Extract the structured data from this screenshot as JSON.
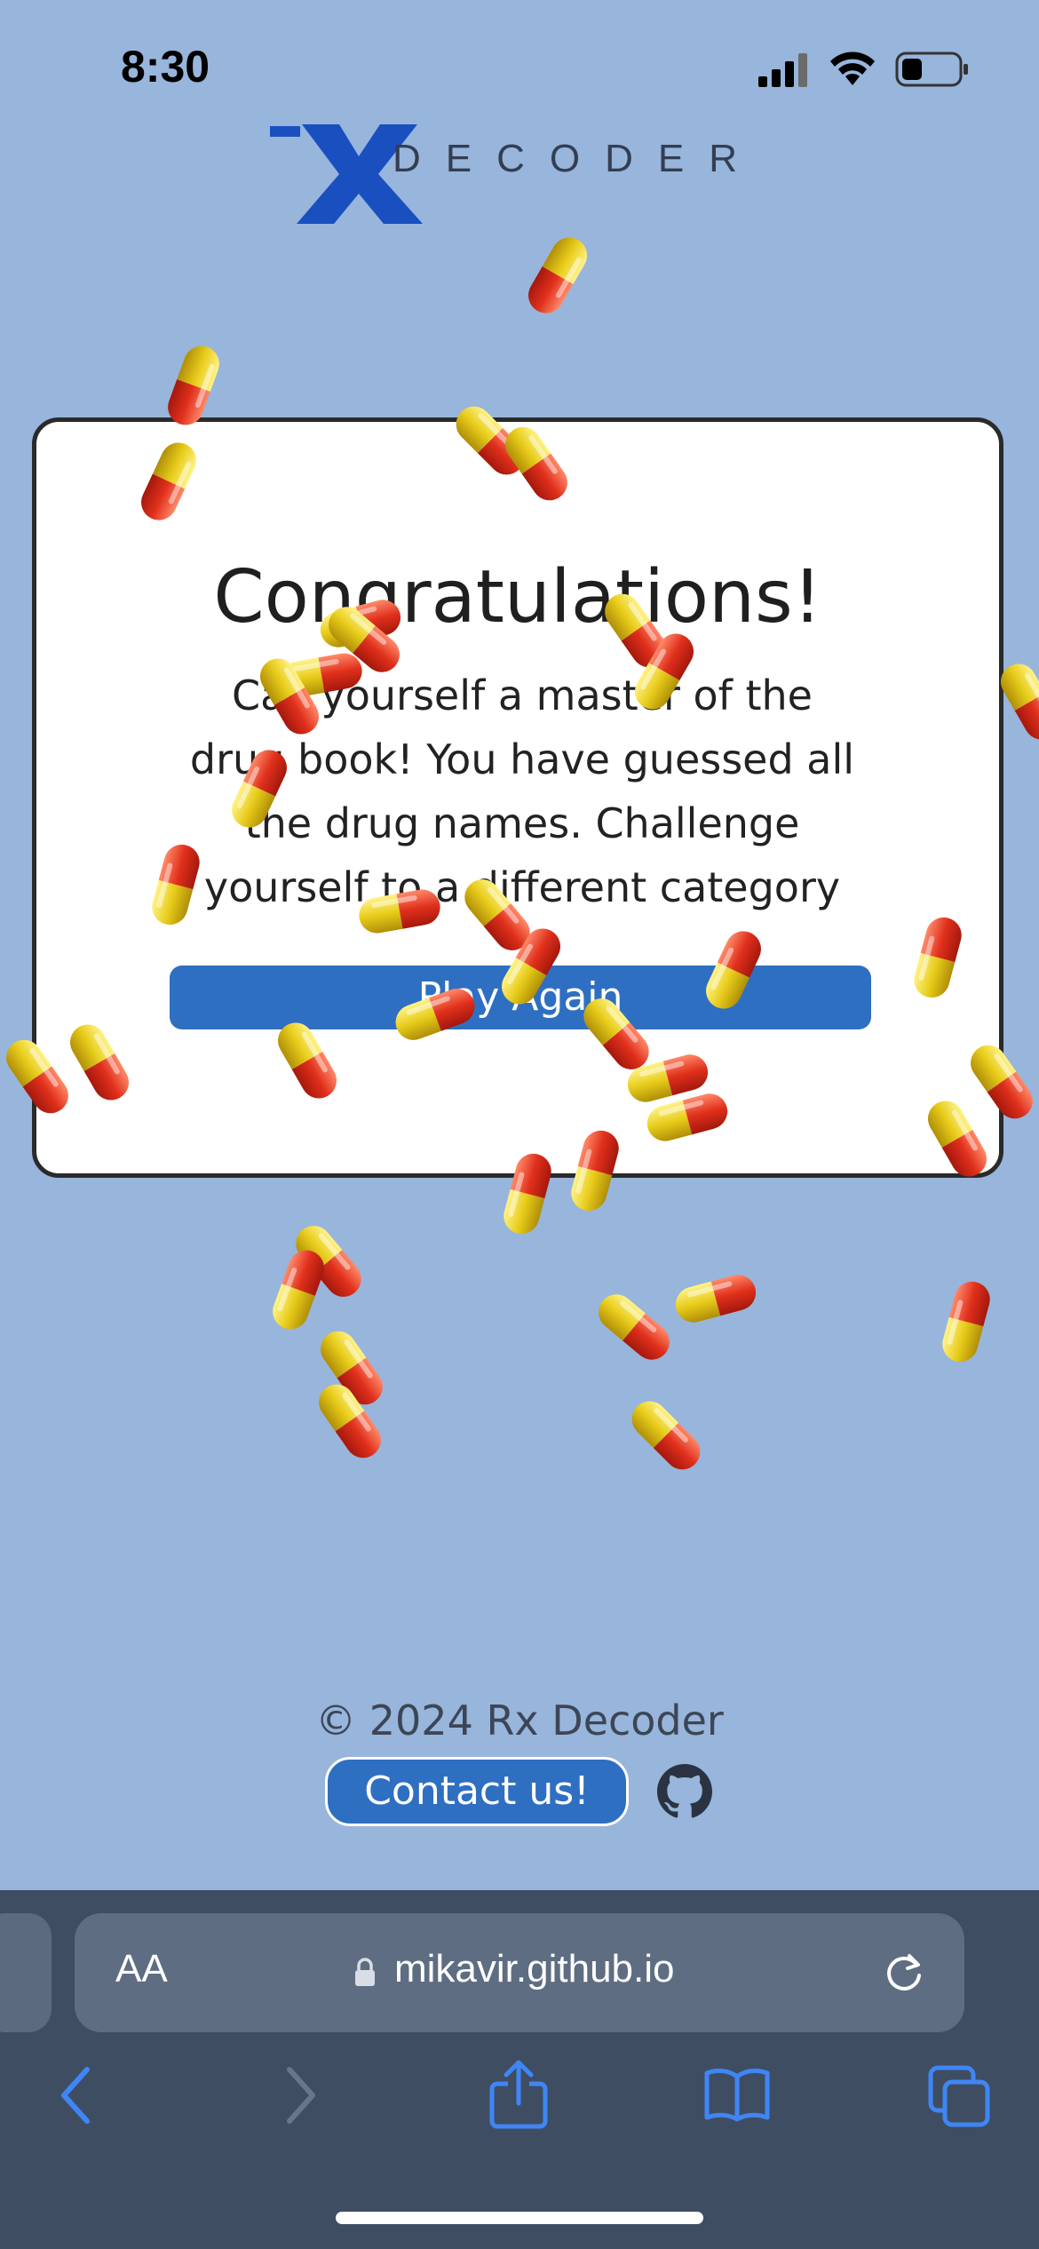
{
  "status_bar": {
    "time": "8:30"
  },
  "logo": {
    "wordmark": "DECODER"
  },
  "modal": {
    "title": "Congratulations!",
    "message": "Call yourself a master of the drug book! You have guessed all the drug names. Challenge yourself to a different category",
    "play_again_label": "Play Again"
  },
  "footer": {
    "copyright": "© 2024 Rx Decoder",
    "contact_label": "Contact us!"
  },
  "browser": {
    "text_size_label": "AA",
    "url": "mikavir.github.io"
  },
  "colors": {
    "background": "#98b5db",
    "accent": "#2f6fc2",
    "browser_bar": "#3f4d63"
  },
  "icons": [
    "signal-icon",
    "wifi-icon",
    "battery-icon",
    "github-icon",
    "lock-icon",
    "reload-icon",
    "back-icon",
    "forward-icon",
    "share-icon",
    "bookmarks-icon",
    "tabs-icon",
    "pill-icon"
  ]
}
